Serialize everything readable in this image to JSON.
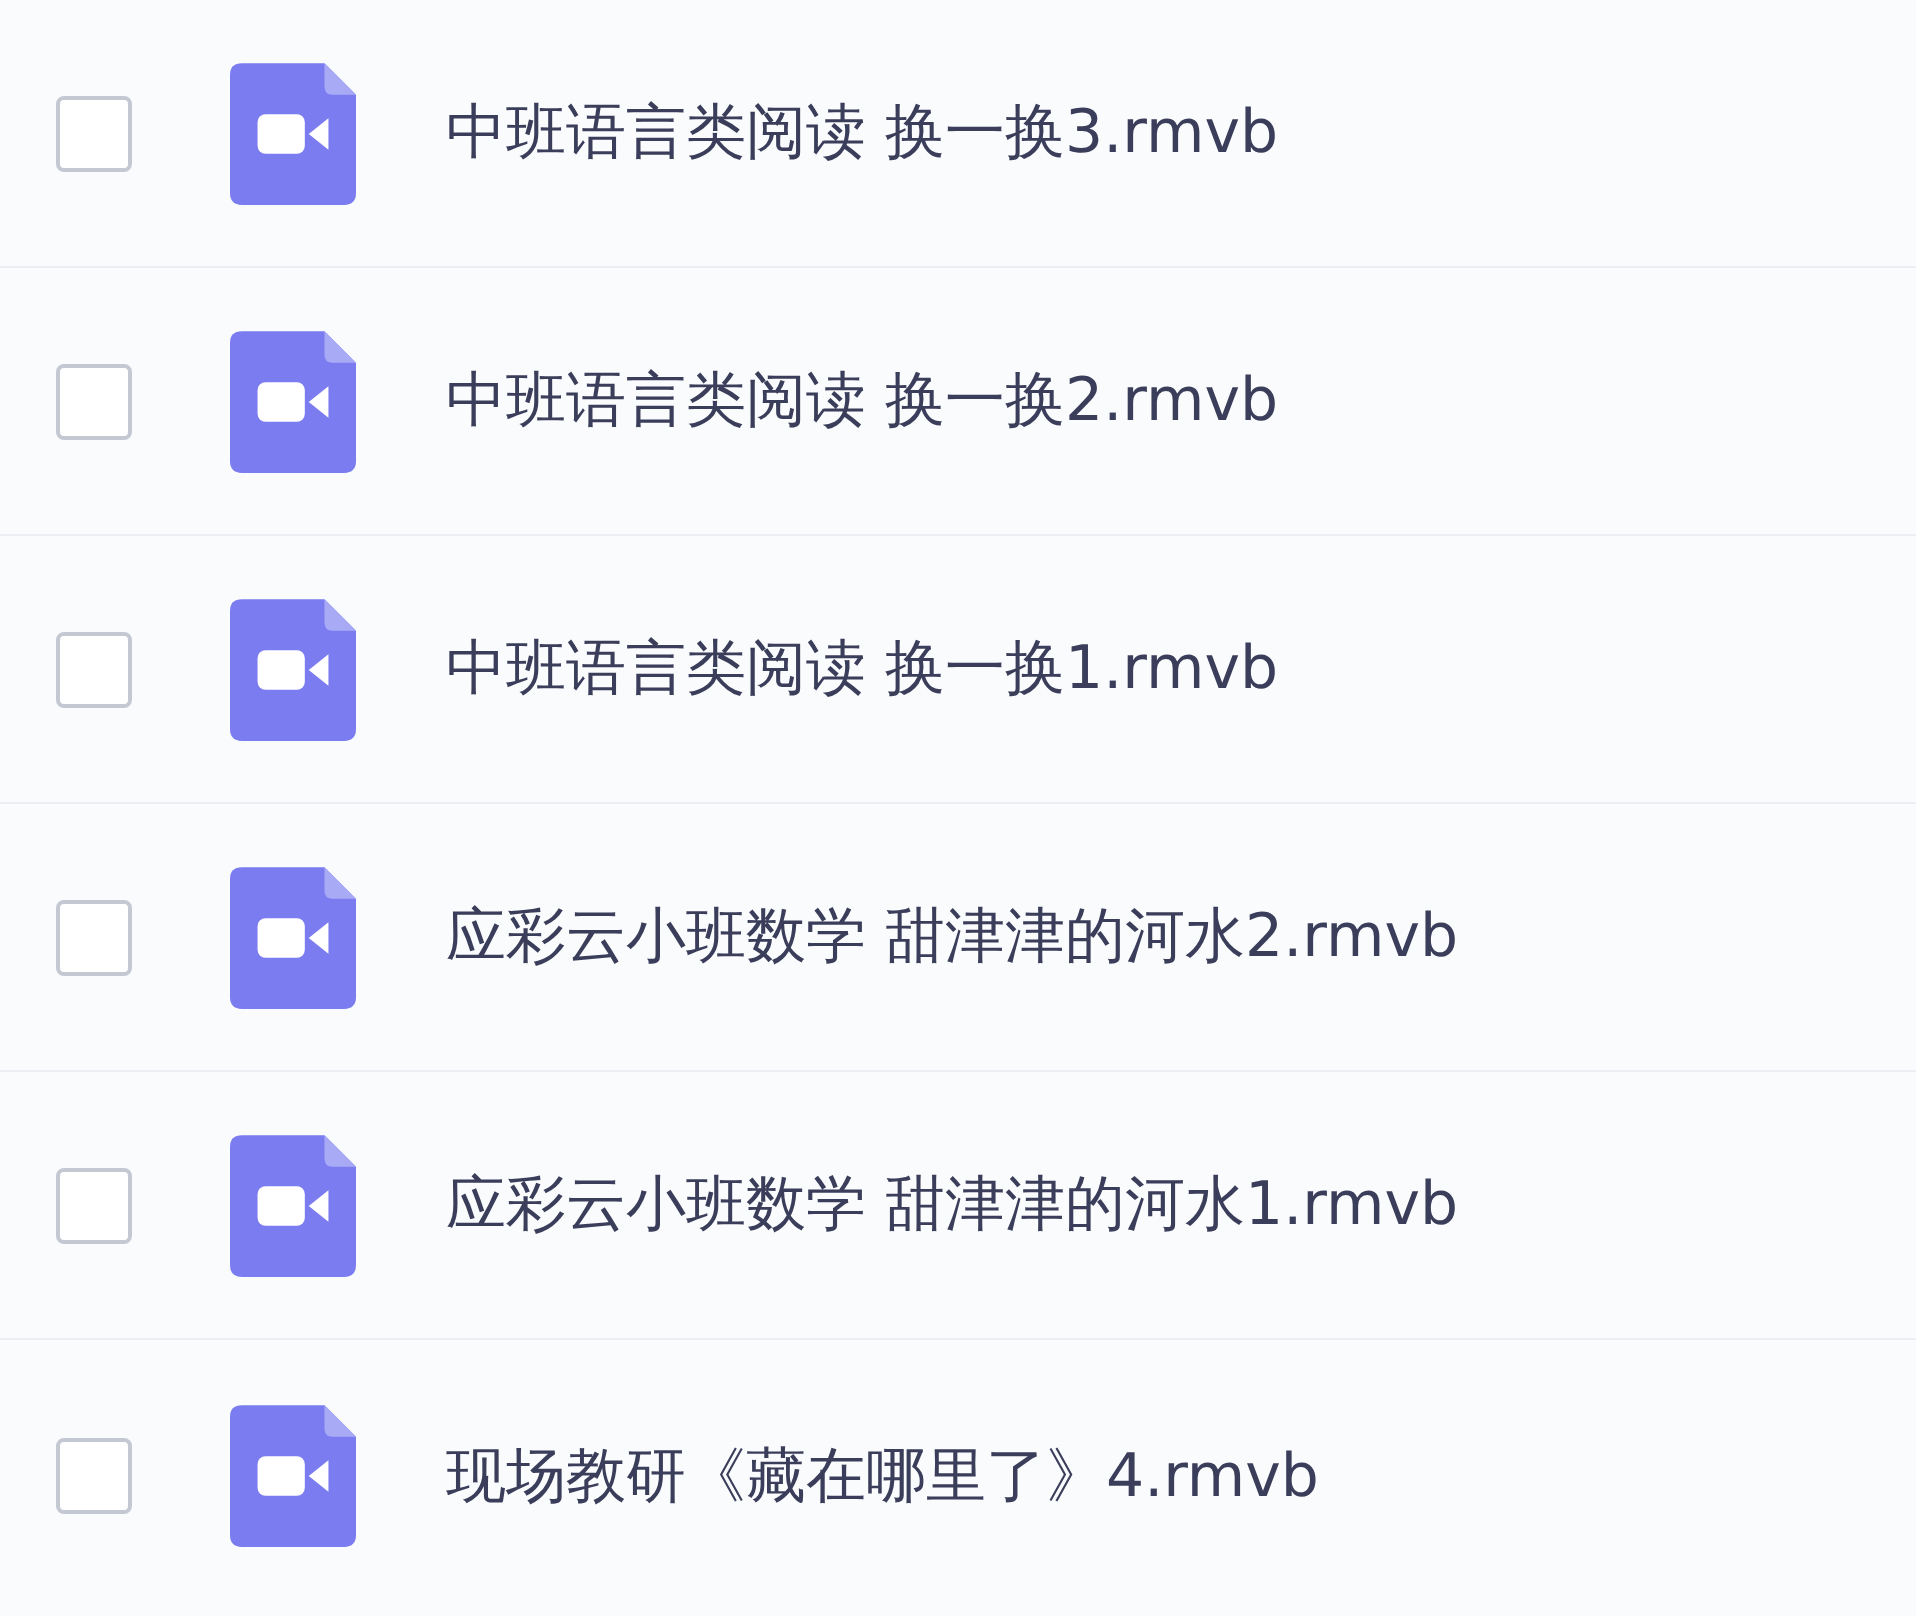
{
  "files": [
    {
      "name": "中班语言类阅读 换一换3.rmvb",
      "checked": false
    },
    {
      "name": "中班语言类阅读 换一换2.rmvb",
      "checked": false
    },
    {
      "name": "中班语言类阅读 换一换1.rmvb",
      "checked": false
    },
    {
      "name": "应彩云小班数学 甜津津的河水2.rmvb",
      "checked": false
    },
    {
      "name": "应彩云小班数学 甜津津的河水1.rmvb",
      "checked": false
    },
    {
      "name": "现场教研《藏在哪里了》4.rmvb",
      "checked": false
    }
  ]
}
